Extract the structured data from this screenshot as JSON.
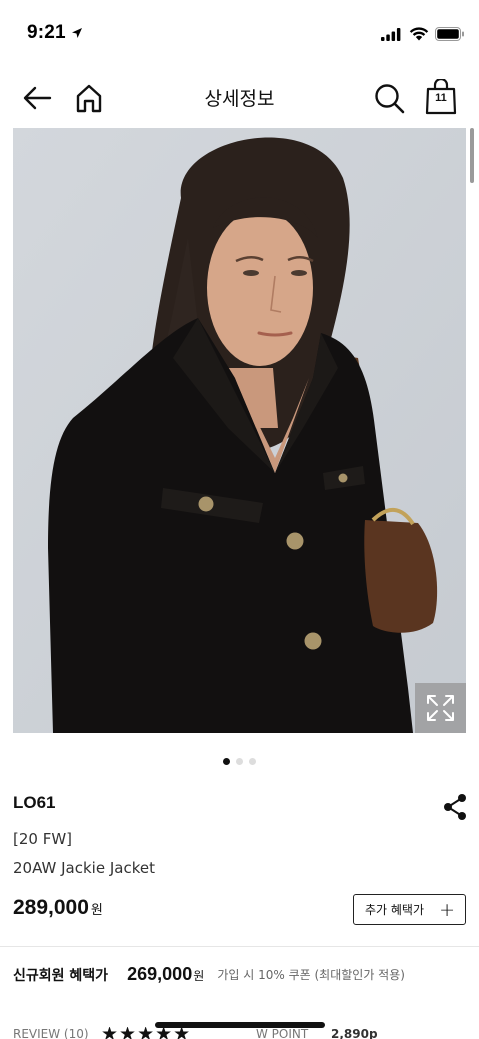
{
  "status_bar": {
    "time": "9:21"
  },
  "header": {
    "title": "상세정보",
    "cart_count": "11"
  },
  "gallery": {
    "total_images": 3,
    "active_index": 0
  },
  "product": {
    "brand": "LO61",
    "season": "[20 FW]",
    "name": "20AW Jackie Jacket",
    "price": "289,000",
    "price_unit": "원",
    "benefit_button_label": "추가 혜택가"
  },
  "member_benefit": {
    "label": "신규회원 혜택가",
    "price": "269,000",
    "unit": "원",
    "note": "가입 시 10% 쿠폰 (최대할인가 적용)"
  },
  "review": {
    "label": "REVIEW (10)",
    "stars": "★★★★★",
    "rating": 5,
    "point_label": "W POINT",
    "point_value": "2,890p"
  }
}
